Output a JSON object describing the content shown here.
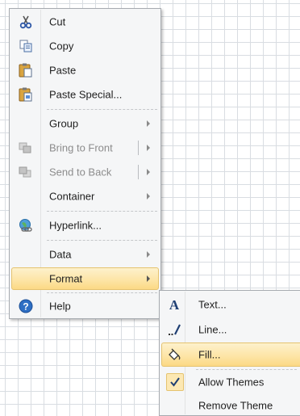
{
  "context_menu": {
    "items": [
      {
        "label": "Cut",
        "icon": "scissors-icon"
      },
      {
        "label": "Copy",
        "icon": "copy-icon"
      },
      {
        "label": "Paste",
        "icon": "clipboard-paste-icon"
      },
      {
        "label": "Paste Special...",
        "icon": "clipboard-paste-special-icon"
      },
      {
        "label": "Group",
        "has_submenu": true
      },
      {
        "label": "Bring to Front",
        "icon": "bring-to-front-icon",
        "disabled": true,
        "split_submenu": true
      },
      {
        "label": "Send to Back",
        "icon": "send-to-back-icon",
        "disabled": true,
        "split_submenu": true
      },
      {
        "label": "Container",
        "has_submenu": true
      },
      {
        "label": "Hyperlink...",
        "icon": "hyperlink-globe-icon"
      },
      {
        "label": "Data",
        "has_submenu": true
      },
      {
        "label": "Format",
        "has_submenu": true,
        "highlighted": true
      },
      {
        "label": "Help",
        "icon": "help-icon"
      }
    ]
  },
  "format_submenu": {
    "items": [
      {
        "label": "Text...",
        "icon": "text-format-icon"
      },
      {
        "label": "Line...",
        "icon": "line-format-icon"
      },
      {
        "label": "Fill...",
        "icon": "fill-bucket-icon",
        "highlighted": true
      },
      {
        "label": "Allow Themes",
        "icon": "checkmark-icon",
        "checked": true
      },
      {
        "label": "Remove Theme"
      }
    ]
  },
  "colors": {
    "menu_background": "#f5f6f7",
    "highlight": "#fde5a7",
    "highlight_border": "#e5c36f",
    "grid_line": "#d9dde2",
    "disabled_text": "#8c8c8c"
  }
}
